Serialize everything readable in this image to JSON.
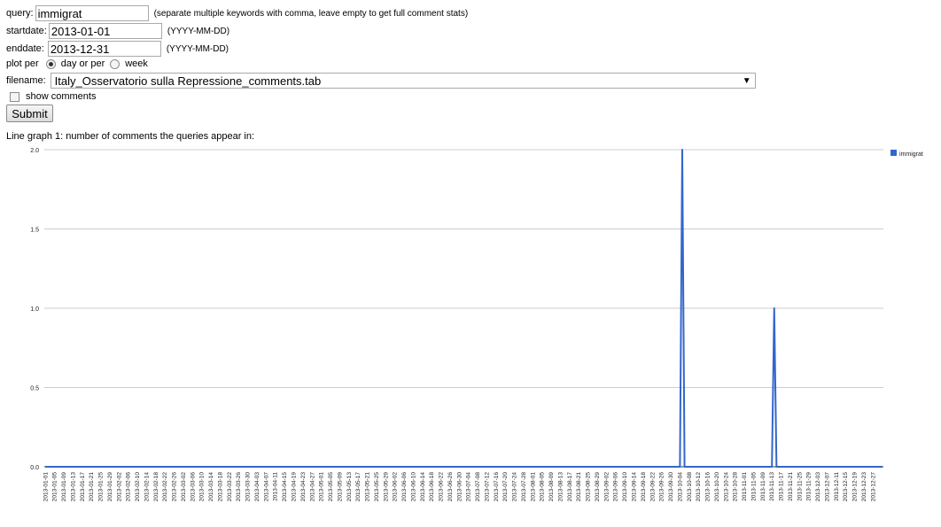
{
  "form": {
    "query_label": "query:",
    "query_value": "immigrat",
    "query_hint": "(separate multiple keywords with comma, leave empty to get full comment stats)",
    "startdate_label": "startdate:",
    "startdate_value": "2013-01-01",
    "startdate_hint": "(YYYY-MM-DD)",
    "enddate_label": "enddate:",
    "enddate_value": "2013-12-31",
    "enddate_hint": "(YYYY-MM-DD)",
    "plotper_label": "plot per",
    "plotper_option_day": "day or per",
    "plotper_option_week": "week",
    "plotper_selected": "day",
    "filename_label": "filename:",
    "filename_value": "Italy_Osservatorio sulla Repressione_comments.tab",
    "show_comments_label": "show comments",
    "show_comments_checked": false,
    "submit_label": "Submit"
  },
  "chart_title": "Line graph 1: number of comments the queries appear in:",
  "chart_data": {
    "type": "line",
    "title": "Line graph 1: number of comments the queries appear in:",
    "xlabel": "",
    "ylabel": "",
    "ylim": [
      0,
      2
    ],
    "yticks": [
      "0.0",
      "0.5",
      "1.0",
      "1.5",
      "2.0"
    ],
    "grid": true,
    "legend_position": "right",
    "x_tick_labels": [
      "2013-01-01",
      "2013-01-05",
      "2013-01-09",
      "2013-01-13",
      "2013-01-17",
      "2013-01-21",
      "2013-01-25",
      "2013-01-29",
      "2013-02-02",
      "2013-02-06",
      "2013-02-10",
      "2013-02-14",
      "2013-02-18",
      "2013-02-22",
      "2013-02-26",
      "2013-03-02",
      "2013-03-06",
      "2013-03-10",
      "2013-03-14",
      "2013-03-18",
      "2013-03-22",
      "2013-03-26",
      "2013-03-30",
      "2013-04-03",
      "2013-04-07",
      "2013-04-11",
      "2013-04-15",
      "2013-04-19",
      "2013-04-23",
      "2013-04-27",
      "2013-05-01",
      "2013-05-05",
      "2013-05-09",
      "2013-05-13",
      "2013-05-17",
      "2013-05-21",
      "2013-05-25",
      "2013-05-29",
      "2013-06-02",
      "2013-06-06",
      "2013-06-10",
      "2013-06-14",
      "2013-06-18",
      "2013-06-22",
      "2013-06-26",
      "2013-06-30",
      "2013-07-04",
      "2013-07-08",
      "2013-07-12",
      "2013-07-16",
      "2013-07-20",
      "2013-07-24",
      "2013-07-28",
      "2013-08-01",
      "2013-08-05",
      "2013-08-09",
      "2013-08-13",
      "2013-08-17",
      "2013-08-21",
      "2013-08-25",
      "2013-08-29",
      "2013-09-02",
      "2013-09-06",
      "2013-09-10",
      "2013-09-14",
      "2013-09-18",
      "2013-09-22",
      "2013-09-26",
      "2013-09-30",
      "2013-10-04",
      "2013-10-08",
      "2013-10-12",
      "2013-10-16",
      "2013-10-20",
      "2013-10-24",
      "2013-10-28",
      "2013-11-01",
      "2013-11-05",
      "2013-11-09",
      "2013-11-13",
      "2013-11-17",
      "2013-11-21",
      "2013-11-25",
      "2013-11-29",
      "2013-12-03",
      "2013-12-07",
      "2013-12-11",
      "2013-12-15",
      "2013-12-19",
      "2013-12-23",
      "2013-12-27"
    ],
    "x_start": "2013-01-01",
    "x_end": "2013-12-31",
    "series": [
      {
        "name": "immigrat",
        "color": "#3366cc",
        "points": [
          {
            "date": "2013-10-05",
            "value": 2
          },
          {
            "date": "2013-11-14",
            "value": 1
          }
        ],
        "default_value": 0
      }
    ]
  }
}
